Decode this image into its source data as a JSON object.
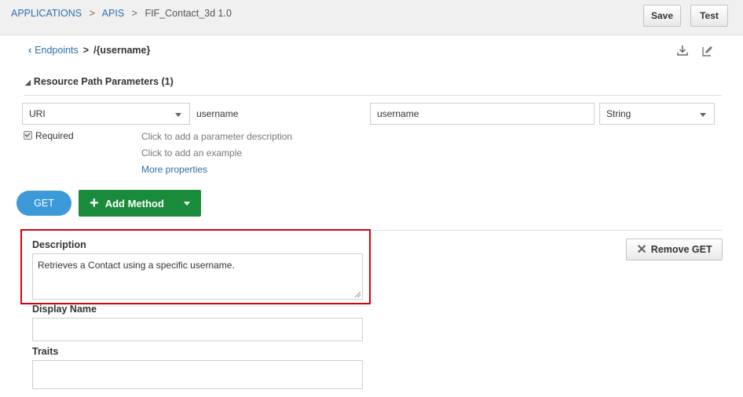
{
  "breadcrumb": {
    "applications": "APPLICATIONS",
    "separator": ">",
    "apis": "APIS",
    "current": "FIF_Contact_3d  1.0"
  },
  "toolbar": {
    "save_label": "Save",
    "test_label": "Test"
  },
  "subheader": {
    "endpoints_link": "Endpoints",
    "separator": ">",
    "path": "/{username}",
    "icons": [
      "download-icon",
      "edit-icon"
    ]
  },
  "resource_params": {
    "title": "Resource Path Parameters (1)",
    "param": {
      "location": "URI",
      "name": "username",
      "value": "username",
      "type": "String",
      "required_label": "Required",
      "required_checked": true,
      "description_hint": "Click to add a parameter description",
      "example_hint": "Click to add an example",
      "more_link": "More properties"
    }
  },
  "methods": {
    "get_label": "GET",
    "add_label": "Add Method"
  },
  "method_form": {
    "description_label": "Description",
    "description_value": "Retrieves a Contact using a specific username.",
    "display_name_label": "Display Name",
    "display_name_value": "",
    "traits_label": "Traits",
    "traits_value": "",
    "remove_label": "Remove GET"
  },
  "colors": {
    "link": "#2f6dad",
    "get_button": "#3d9ad8",
    "add_method": "#1a8b3b",
    "highlight": "#d9000d"
  }
}
